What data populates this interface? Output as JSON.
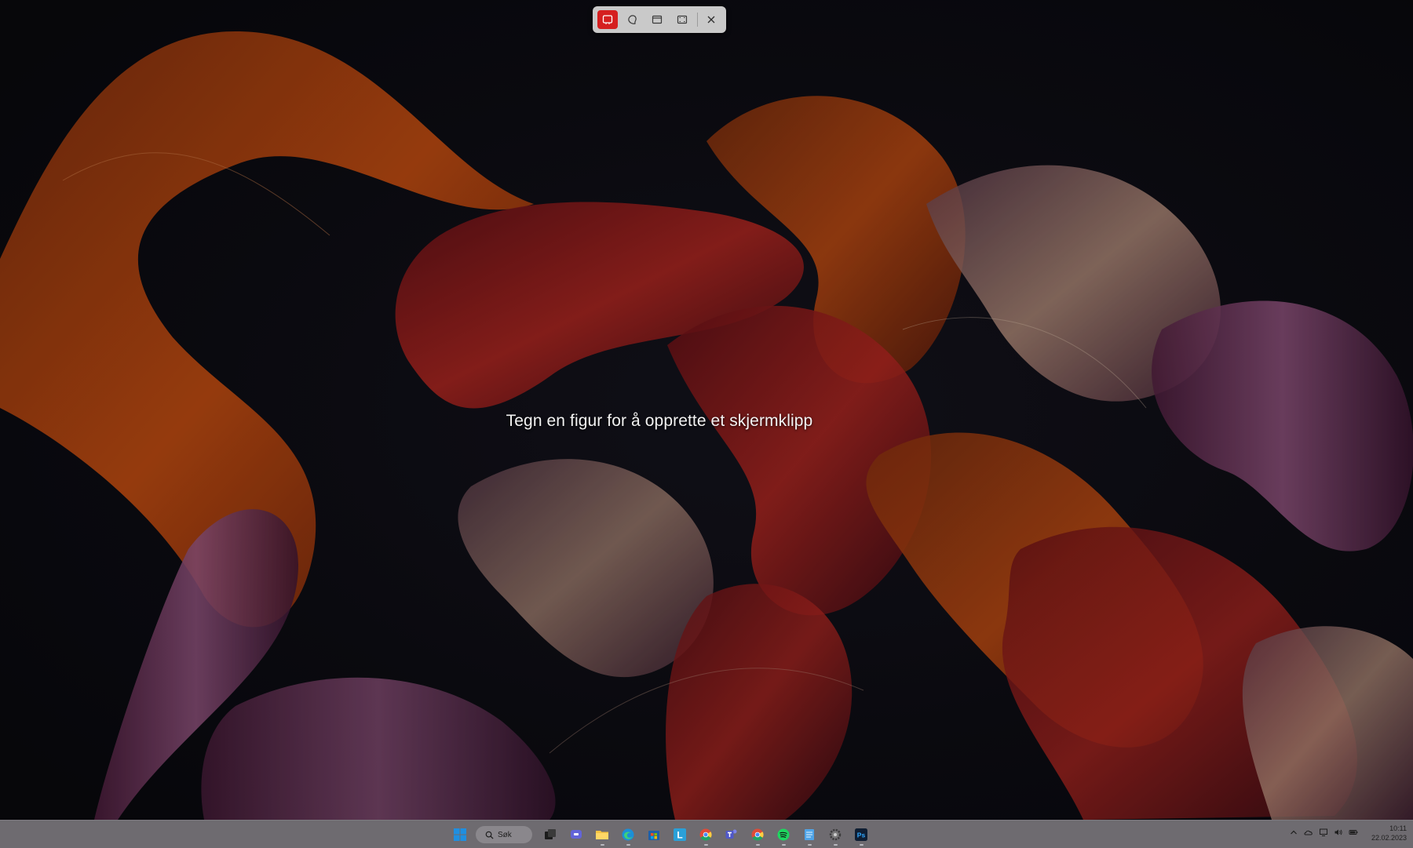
{
  "snip_toolbar": {
    "modes": [
      {
        "name": "rectangle",
        "icon": "rectangle-snip-icon",
        "active": true
      },
      {
        "name": "freeform",
        "icon": "freeform-snip-icon",
        "active": false
      },
      {
        "name": "window",
        "icon": "window-snip-icon",
        "active": false
      },
      {
        "name": "fullscreen",
        "icon": "fullscreen-snip-icon",
        "active": false
      }
    ],
    "close_icon": "close-icon",
    "accent": "#d51f1f"
  },
  "instruction": "Tegn en figur for å opprette et skjermklipp",
  "taskbar": {
    "start_icon": "windows-start-icon",
    "search_label": "Søk",
    "apps": [
      {
        "icon": "task-view-icon",
        "open": false
      },
      {
        "icon": "teams-chat-icon",
        "open": false
      },
      {
        "icon": "file-explorer-icon",
        "open": true
      },
      {
        "icon": "edge-icon",
        "open": true
      },
      {
        "icon": "microsoft-store-icon",
        "open": false
      },
      {
        "icon": "l-app-icon",
        "open": false
      },
      {
        "icon": "chrome-icon",
        "open": true
      },
      {
        "icon": "teams-icon",
        "open": false
      },
      {
        "icon": "chrome-icon",
        "open": true
      },
      {
        "icon": "spotify-icon",
        "open": true
      },
      {
        "icon": "notepad-icon",
        "open": true
      },
      {
        "icon": "settings-icon",
        "open": true
      },
      {
        "icon": "photoshop-icon",
        "open": true
      }
    ],
    "photoshop_label": "Ps",
    "l_app_label": "L",
    "tray": [
      "chevron-up-icon",
      "onedrive-icon",
      "network-icon",
      "volume-icon",
      "battery-icon"
    ],
    "clock": {
      "time": "10:11",
      "date": "22.02.2023"
    }
  }
}
